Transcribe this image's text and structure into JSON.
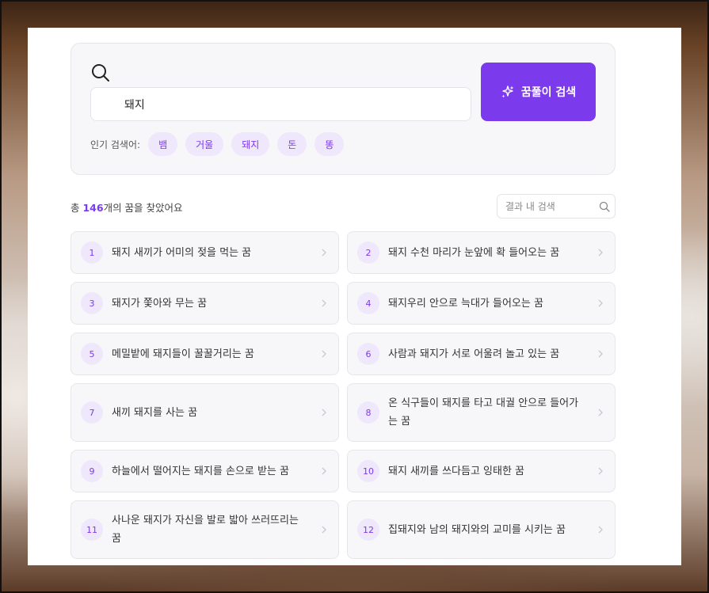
{
  "search": {
    "value": "돼지",
    "button_label": "꿈풀이 검색"
  },
  "popular": {
    "label": "인기 검색어:",
    "tags": [
      "뱀",
      "거울",
      "돼지",
      "돈",
      "똥"
    ]
  },
  "summary": {
    "prefix": "총 ",
    "count": "146",
    "suffix": "개의 꿈을 찾았어요"
  },
  "filter": {
    "placeholder": "결과 내 검색"
  },
  "results": [
    {
      "num": "1",
      "title": "돼지 새끼가 어미의 젖을 먹는 꿈"
    },
    {
      "num": "2",
      "title": "돼지 수천 마리가 눈앞에 확 들어오는 꿈"
    },
    {
      "num": "3",
      "title": "돼지가 쫓아와 무는 꿈"
    },
    {
      "num": "4",
      "title": "돼지우리 안으로 늑대가 들어오는 꿈"
    },
    {
      "num": "5",
      "title": "메밀밭에 돼지들이 꿀꿀거리는 꿈"
    },
    {
      "num": "6",
      "title": "사람과 돼지가 서로 어울려 놀고 있는 꿈"
    },
    {
      "num": "7",
      "title": "새끼 돼지를 사는 꿈"
    },
    {
      "num": "8",
      "title": "온 식구들이 돼지를 타고 대궐 안으로 들어가는 꿈"
    },
    {
      "num": "9",
      "title": "하늘에서 떨어지는 돼지를 손으로 받는 꿈"
    },
    {
      "num": "10",
      "title": "돼지 새끼를 쓰다듬고 잉태한 꿈"
    },
    {
      "num": "11",
      "title": "사나운 돼지가 자신을 발로 밟아 쓰러뜨리는 꿈"
    },
    {
      "num": "12",
      "title": "집돼지와 남의 돼지와의 교미를 시키는 꿈"
    }
  ],
  "colors": {
    "accent": "#7c3aed",
    "tag_bg": "#efe7fb",
    "card_bg": "#f7f7f9"
  },
  "icons": {
    "search": "search-icon",
    "sparkle": "sparkles-icon",
    "chevron": "chevron-right-icon"
  }
}
